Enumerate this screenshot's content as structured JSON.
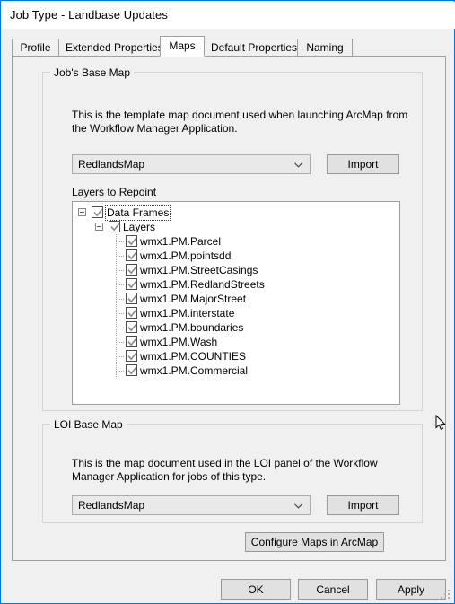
{
  "window": {
    "title": "Job Type - Landbase Updates",
    "accent_color": "#0078d7",
    "body_color": "#f0f0f0"
  },
  "tabs": [
    {
      "label": "Profile",
      "active": false
    },
    {
      "label": "Extended Properties",
      "active": false
    },
    {
      "label": "Maps",
      "active": true
    },
    {
      "label": "Default Properties",
      "active": false
    },
    {
      "label": "Naming",
      "active": false
    }
  ],
  "jobs_base_map": {
    "legend": "Job's Base Map",
    "description_line1": "This is the template map document used when launching ArcMap from",
    "description_line2": "the Workflow Manager Application.",
    "combo_value": "RedlandsMap",
    "import_label": "Import"
  },
  "layers_to_repoint": {
    "label": "Layers to Repoint",
    "nodes": [
      {
        "text": "Data Frames",
        "depth": 0,
        "expandable": true,
        "checked": true,
        "focused": true
      },
      {
        "text": "Layers",
        "depth": 1,
        "expandable": true,
        "checked": true,
        "focused": false
      },
      {
        "text": "wmx1.PM.Parcel",
        "depth": 2,
        "expandable": false,
        "checked": true,
        "focused": false
      },
      {
        "text": "wmx1.PM.pointsdd",
        "depth": 2,
        "expandable": false,
        "checked": true,
        "focused": false
      },
      {
        "text": "wmx1.PM.StreetCasings",
        "depth": 2,
        "expandable": false,
        "checked": true,
        "focused": false
      },
      {
        "text": "wmx1.PM.RedlandStreets",
        "depth": 2,
        "expandable": false,
        "checked": true,
        "focused": false
      },
      {
        "text": "wmx1.PM.MajorStreet",
        "depth": 2,
        "expandable": false,
        "checked": true,
        "focused": false
      },
      {
        "text": "wmx1.PM.interstate",
        "depth": 2,
        "expandable": false,
        "checked": true,
        "focused": false
      },
      {
        "text": "wmx1.PM.boundaries",
        "depth": 2,
        "expandable": false,
        "checked": true,
        "focused": false
      },
      {
        "text": "wmx1.PM.Wash",
        "depth": 2,
        "expandable": false,
        "checked": true,
        "focused": false
      },
      {
        "text": "wmx1.PM.COUNTIES",
        "depth": 2,
        "expandable": false,
        "checked": true,
        "focused": false
      },
      {
        "text": "wmx1.PM.Commercial",
        "depth": 2,
        "expandable": false,
        "checked": true,
        "focused": false
      }
    ]
  },
  "loi_base_map": {
    "legend": "LOI Base Map",
    "description_line1": "This is the map document used in the LOI panel of the Workflow",
    "description_line2": "Manager Application for jobs of this type.",
    "combo_value": "RedlandsMap",
    "import_label": "Import"
  },
  "configure_button": {
    "label": "Configure Maps in ArcMap"
  },
  "footer": {
    "ok_label": "OK",
    "cancel_label": "Cancel",
    "apply_label": "Apply"
  }
}
